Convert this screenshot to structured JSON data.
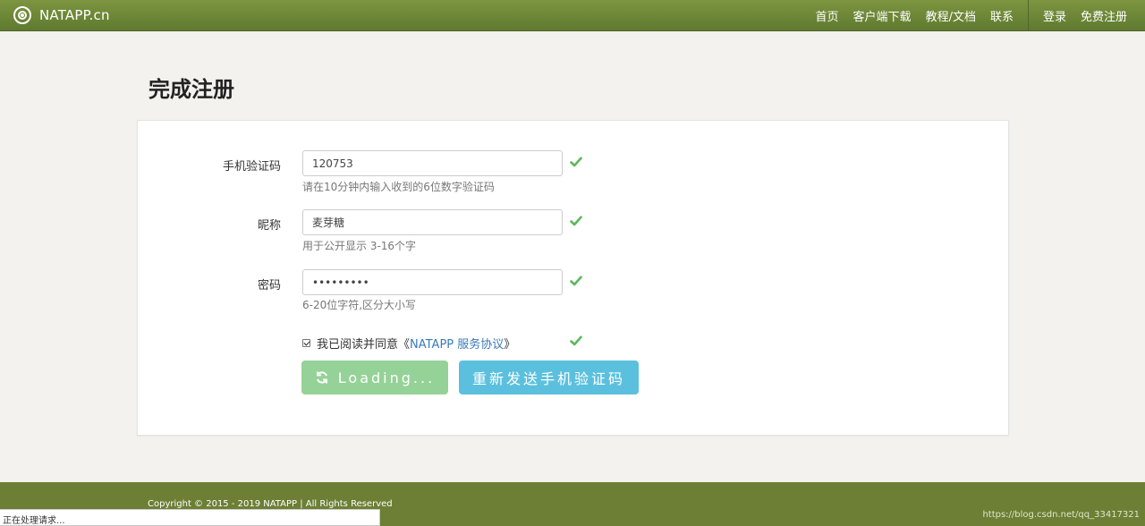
{
  "header": {
    "brand": "NATAPP.cn",
    "nav": {
      "home": "首页",
      "download": "客户端下载",
      "docs": "教程/文档",
      "contact": "联系",
      "login": "登录",
      "register": "免费注册"
    }
  },
  "page": {
    "title": "完成注册"
  },
  "form": {
    "sms_code": {
      "label": "手机验证码",
      "value": "120753",
      "help": "请在10分钟内输入收到的6位数字验证码"
    },
    "nickname": {
      "label": "昵称",
      "value": "麦芽糖",
      "help": "用于公开显示 3-16个字"
    },
    "password": {
      "label": "密码",
      "value": "•••••••••",
      "help": "6-20位字符,区分大小写"
    },
    "agreement": {
      "prefix": "我已阅读并同意《",
      "link": "NATAPP 服务协议",
      "suffix": "》"
    },
    "buttons": {
      "loading": "Loading...",
      "resend": "重新发送手机验证码"
    }
  },
  "icons": {
    "valid": "check-icon",
    "refresh": "refresh-icon",
    "logo": "natapp-logo-icon"
  },
  "colors": {
    "navbar": "#6d8638",
    "footer": "#6c7f34",
    "valid_check": "#5cb85c",
    "loading_button": "#95d297",
    "resend_button": "#5bc0de"
  },
  "footer": {
    "copyright": "Copyright © 2015 - 2019 NATAPP  |  All Rights Reserved",
    "watermark": "https://blog.csdn.net/qq_33417321"
  },
  "status_bar": {
    "text": "正在处理请求..."
  }
}
